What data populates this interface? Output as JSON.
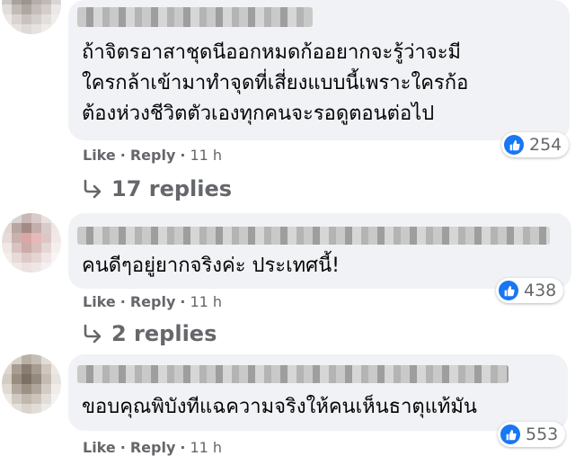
{
  "comments": [
    {
      "text": "ถ้าจิตรอาสาชุดนีออกหมดก้ออยากจะรู้ว่าจะมี\nใครกล้าเข้ามาทำจุดที่เสี่ยงแบบนี้เพราะใครก้อ\nต้องห่วงชีวิตตัวเองทุกคนจะรอดูตอนต่อไป",
      "reactions": "254",
      "like": "Like",
      "reply": "Reply",
      "time": "11 h",
      "replies": "17 replies"
    },
    {
      "text": "คนดีๆอยู่ยากจริงค่ะ ประเทศนี้!",
      "reactions": "438",
      "like": "Like",
      "reply": "Reply",
      "time": "11 h",
      "replies": "2 replies"
    },
    {
      "text": "ขอบคุณพิบังทีแฉความจริงให้คนเห็นธาตุแท้มัน",
      "reactions": "553",
      "like": "Like",
      "reply": "Reply",
      "time": "11 h"
    }
  ],
  "separator": "·",
  "icons": {
    "reaction": "thumbs-up-icon",
    "reply": "reply-arrow-icon"
  },
  "colors": {
    "bubble": "#f0f2f5",
    "like_blue": "#1877f2",
    "meta_gray": "#65676b"
  }
}
